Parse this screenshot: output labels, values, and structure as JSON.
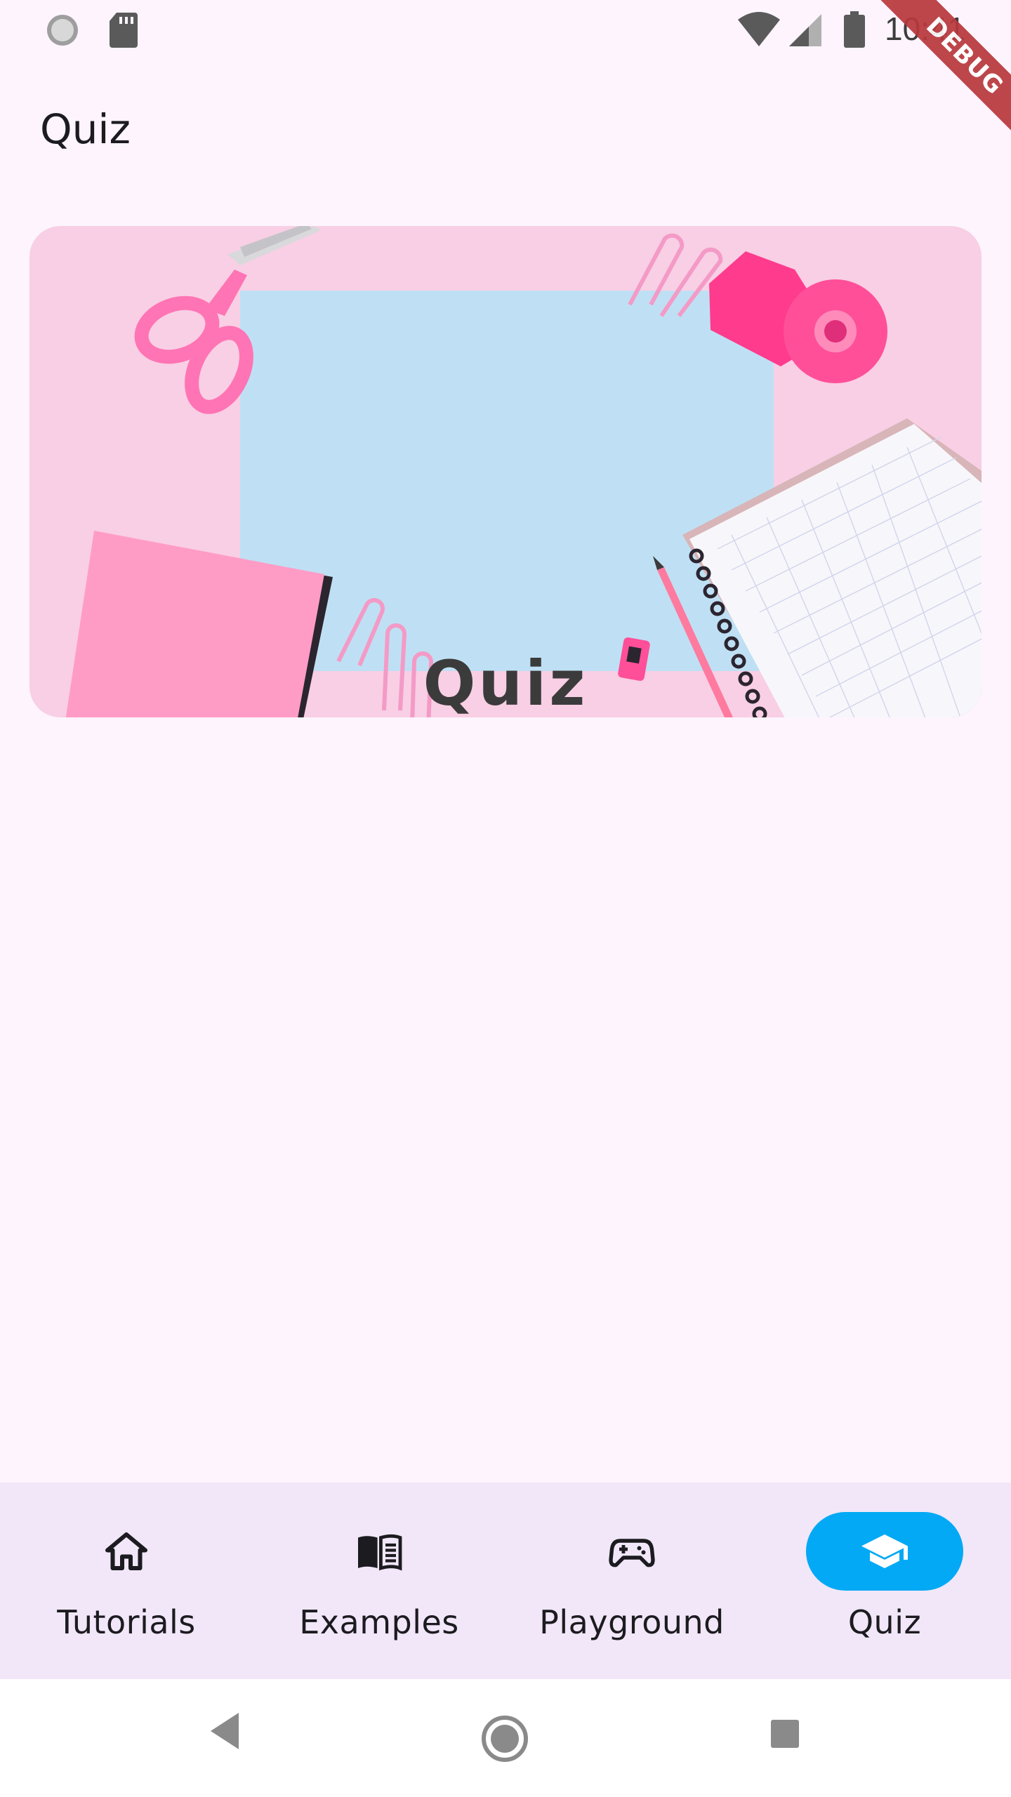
{
  "status_bar": {
    "time": "10:41",
    "icons": [
      "loading-icon",
      "sd-card-icon",
      "wifi-icon",
      "signal-icon",
      "battery-icon"
    ],
    "debug_label": "DEBUG"
  },
  "app_bar": {
    "title": "Quiz"
  },
  "banner": {
    "title": "Quiz",
    "colors": {
      "background": "#f8cfe4",
      "paper": "#bfe0f4",
      "accent": "#ff5fa8"
    }
  },
  "bottom_nav": {
    "items": [
      {
        "label": "Tutorials",
        "icon": "home-icon",
        "active": false
      },
      {
        "label": "Examples",
        "icon": "book-icon",
        "active": false
      },
      {
        "label": "Playground",
        "icon": "gamepad-icon",
        "active": false
      },
      {
        "label": "Quiz",
        "icon": "school-icon",
        "active": true
      }
    ],
    "active_color": "#03a9f4",
    "background": "#f1e7f9"
  },
  "system_nav": {
    "buttons": [
      "back-icon",
      "home-circle-icon",
      "recents-icon"
    ]
  }
}
